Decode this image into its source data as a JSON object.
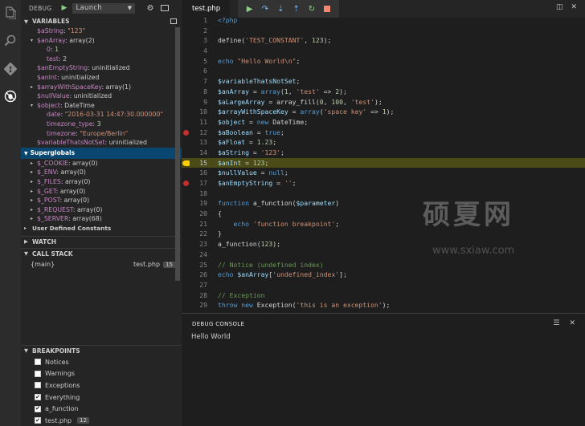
{
  "debug_header": {
    "title": "DEBUG",
    "config": "Launch"
  },
  "variables": {
    "title": "VARIABLES",
    "rows": [
      {
        "indent": 1,
        "toggle": "",
        "name": "$aString",
        "sep": ": ",
        "value": "\"123\"",
        "kind": "str"
      },
      {
        "indent": 1,
        "toggle": "▾",
        "name": "$anArray",
        "sep": ": ",
        "value": "array(2)",
        "kind": "plain"
      },
      {
        "indent": 2,
        "toggle": "",
        "name": "0",
        "sep": ": ",
        "value": "1",
        "kind": "num"
      },
      {
        "indent": 2,
        "toggle": "",
        "name": "test",
        "sep": ": ",
        "value": "2",
        "kind": "num"
      },
      {
        "indent": 1,
        "toggle": "",
        "name": "$anEmptyString",
        "sep": ": ",
        "value": "uninitialized",
        "kind": "plain"
      },
      {
        "indent": 1,
        "toggle": "",
        "name": "$anInt",
        "sep": ": ",
        "value": "uninitialized",
        "kind": "plain"
      },
      {
        "indent": 1,
        "toggle": "▸",
        "name": "$arrayWithSpaceKey",
        "sep": ": ",
        "value": "array(1)",
        "kind": "plain"
      },
      {
        "indent": 1,
        "toggle": "",
        "name": "$nullValue",
        "sep": ": ",
        "value": "uninitialized",
        "kind": "plain"
      },
      {
        "indent": 1,
        "toggle": "▾",
        "name": "$object",
        "sep": ": ",
        "value": "DateTime",
        "kind": "plain"
      },
      {
        "indent": 2,
        "toggle": "",
        "name": "date",
        "sep": ": ",
        "value": "\"2016-03-31 14:47:30.000000\"",
        "kind": "str"
      },
      {
        "indent": 2,
        "toggle": "",
        "name": "timezone_type",
        "sep": ": ",
        "value": "3",
        "kind": "num"
      },
      {
        "indent": 2,
        "toggle": "",
        "name": "timezone",
        "sep": ": ",
        "value": "\"Europe/Berlin\"",
        "kind": "str"
      },
      {
        "indent": 1,
        "toggle": "",
        "name": "$variableThatsNotSet",
        "sep": ": ",
        "value": "uninitialized",
        "kind": "plain"
      }
    ]
  },
  "superglobals": {
    "title": "Superglobals",
    "rows": [
      {
        "name": "$_COOKIE",
        "value": "array(0)"
      },
      {
        "name": "$_ENV",
        "value": "array(0)"
      },
      {
        "name": "$_FILES",
        "value": "array(0)"
      },
      {
        "name": "$_GET",
        "value": "array(0)"
      },
      {
        "name": "$_POST",
        "value": "array(0)"
      },
      {
        "name": "$_REQUEST",
        "value": "array(0)"
      },
      {
        "name": "$_SERVER",
        "value": "array(68)"
      }
    ],
    "user_defined": "User Defined Constants"
  },
  "watch": {
    "title": "WATCH"
  },
  "call_stack": {
    "title": "CALL STACK",
    "frame": "{main}",
    "file": "test.php",
    "line": "15"
  },
  "breakpoints": {
    "title": "BREAKPOINTS",
    "items": [
      {
        "label": "Notices",
        "checked": false,
        "badge": ""
      },
      {
        "label": "Warnings",
        "checked": false,
        "badge": ""
      },
      {
        "label": "Exceptions",
        "checked": false,
        "badge": ""
      },
      {
        "label": "Everything",
        "checked": true,
        "badge": ""
      },
      {
        "label": "a_function",
        "checked": true,
        "badge": ""
      },
      {
        "label": "test.php",
        "checked": true,
        "badge": "12"
      }
    ]
  },
  "editor": {
    "tab": "test.php",
    "lines": [
      {
        "n": "1",
        "code": [
          [
            "t-kw",
            "<?php"
          ]
        ]
      },
      {
        "n": "2",
        "code": []
      },
      {
        "n": "3",
        "code": [
          [
            "t-pl",
            "define("
          ],
          [
            "t-str",
            "'TEST_CONSTANT'"
          ],
          [
            "t-pl",
            ", "
          ],
          [
            "t-num",
            "123"
          ],
          [
            "t-pl",
            ");"
          ]
        ]
      },
      {
        "n": "4",
        "code": []
      },
      {
        "n": "5",
        "code": [
          [
            "t-kw",
            "echo "
          ],
          [
            "t-str",
            "\"Hello World\\n\""
          ],
          [
            "t-pl",
            ";"
          ]
        ]
      },
      {
        "n": "6",
        "code": []
      },
      {
        "n": "7",
        "code": [
          [
            "t-var",
            "$variableThatsNotSet"
          ],
          [
            "t-pl",
            ";"
          ]
        ]
      },
      {
        "n": "8",
        "code": [
          [
            "t-var",
            "$anArray"
          ],
          [
            "t-pl",
            " = "
          ],
          [
            "t-kw",
            "array"
          ],
          [
            "t-pl",
            "("
          ],
          [
            "t-num",
            "1"
          ],
          [
            "t-pl",
            ", "
          ],
          [
            "t-str",
            "'test'"
          ],
          [
            "t-pl",
            " => "
          ],
          [
            "t-num",
            "2"
          ],
          [
            "t-pl",
            ");"
          ]
        ]
      },
      {
        "n": "9",
        "code": [
          [
            "t-var",
            "$aLargeArray"
          ],
          [
            "t-pl",
            " = array_fill("
          ],
          [
            "t-num",
            "0"
          ],
          [
            "t-pl",
            ", "
          ],
          [
            "t-num",
            "100"
          ],
          [
            "t-pl",
            ", "
          ],
          [
            "t-str",
            "'test'"
          ],
          [
            "t-pl",
            ");"
          ]
        ]
      },
      {
        "n": "10",
        "code": [
          [
            "t-var",
            "$arrayWithSpaceKey"
          ],
          [
            "t-pl",
            " = "
          ],
          [
            "t-kw",
            "array"
          ],
          [
            "t-pl",
            "("
          ],
          [
            "t-str",
            "'space key'"
          ],
          [
            "t-pl",
            " => "
          ],
          [
            "t-num",
            "1"
          ],
          [
            "t-pl",
            ");"
          ]
        ]
      },
      {
        "n": "11",
        "code": [
          [
            "t-var",
            "$object"
          ],
          [
            "t-pl",
            " = "
          ],
          [
            "t-kw",
            "new "
          ],
          [
            "t-pl",
            "DateTime;"
          ]
        ]
      },
      {
        "n": "12",
        "code": [
          [
            "t-var",
            "$aBoolean"
          ],
          [
            "t-pl",
            " = "
          ],
          [
            "t-kw",
            "true"
          ],
          [
            "t-pl",
            ";"
          ]
        ],
        "bp": true
      },
      {
        "n": "13",
        "code": [
          [
            "t-var",
            "$aFloat"
          ],
          [
            "t-pl",
            " = "
          ],
          [
            "t-num",
            "1.23"
          ],
          [
            "t-pl",
            ";"
          ]
        ]
      },
      {
        "n": "14",
        "code": [
          [
            "t-var",
            "$aString"
          ],
          [
            "t-pl",
            " = "
          ],
          [
            "t-str",
            "'123'"
          ],
          [
            "t-pl",
            ";"
          ]
        ]
      },
      {
        "n": "15",
        "code": [
          [
            "t-var",
            "$anInt"
          ],
          [
            "t-pl",
            " = "
          ],
          [
            "t-num",
            "123"
          ],
          [
            "t-pl",
            ";"
          ]
        ],
        "current": true
      },
      {
        "n": "16",
        "code": [
          [
            "t-var",
            "$nullValue"
          ],
          [
            "t-pl",
            " = "
          ],
          [
            "t-kw",
            "null"
          ],
          [
            "t-pl",
            ";"
          ]
        ]
      },
      {
        "n": "17",
        "code": [
          [
            "t-var",
            "$anEmptyString"
          ],
          [
            "t-pl",
            " = "
          ],
          [
            "t-str",
            "''"
          ],
          [
            "t-pl",
            ";"
          ]
        ],
        "bp": true
      },
      {
        "n": "18",
        "code": []
      },
      {
        "n": "19",
        "code": [
          [
            "t-kw",
            "function "
          ],
          [
            "t-pl",
            "a_function("
          ],
          [
            "t-var",
            "$parameter"
          ],
          [
            "t-pl",
            ")"
          ]
        ]
      },
      {
        "n": "20",
        "code": [
          [
            "t-pl",
            "{"
          ]
        ]
      },
      {
        "n": "21",
        "code": [
          [
            "t-pl",
            "    "
          ],
          [
            "t-kw",
            "echo "
          ],
          [
            "t-str",
            "'function breakpoint'"
          ],
          [
            "t-pl",
            ";"
          ]
        ]
      },
      {
        "n": "22",
        "code": [
          [
            "t-pl",
            "}"
          ]
        ]
      },
      {
        "n": "23",
        "code": [
          [
            "t-pl",
            "a_function("
          ],
          [
            "t-num",
            "123"
          ],
          [
            "t-pl",
            ");"
          ]
        ]
      },
      {
        "n": "24",
        "code": []
      },
      {
        "n": "25",
        "code": [
          [
            "t-com",
            "// Notice (undefined index)"
          ]
        ]
      },
      {
        "n": "26",
        "code": [
          [
            "t-kw",
            "echo "
          ],
          [
            "t-var",
            "$anArray"
          ],
          [
            "t-pl",
            "["
          ],
          [
            "t-str",
            "'undefined_index'"
          ],
          [
            "t-pl",
            "];"
          ]
        ]
      },
      {
        "n": "27",
        "code": []
      },
      {
        "n": "28",
        "code": [
          [
            "t-com",
            "// Exception"
          ]
        ]
      },
      {
        "n": "29",
        "code": [
          [
            "t-kw",
            "throw new "
          ],
          [
            "t-pl",
            "Exception("
          ],
          [
            "t-str",
            "'this is an exception'"
          ],
          [
            "t-pl",
            ");"
          ]
        ]
      }
    ]
  },
  "console": {
    "title": "DEBUG CONSOLE",
    "output": "Hello World"
  },
  "watermark": {
    "text": "硕夏网",
    "url": "www.sxiaw.com"
  },
  "colors": {
    "highlight": "#4b4b18",
    "breakpoint": "#c5302e",
    "current": "#ffcc00",
    "selection": "#094771"
  }
}
